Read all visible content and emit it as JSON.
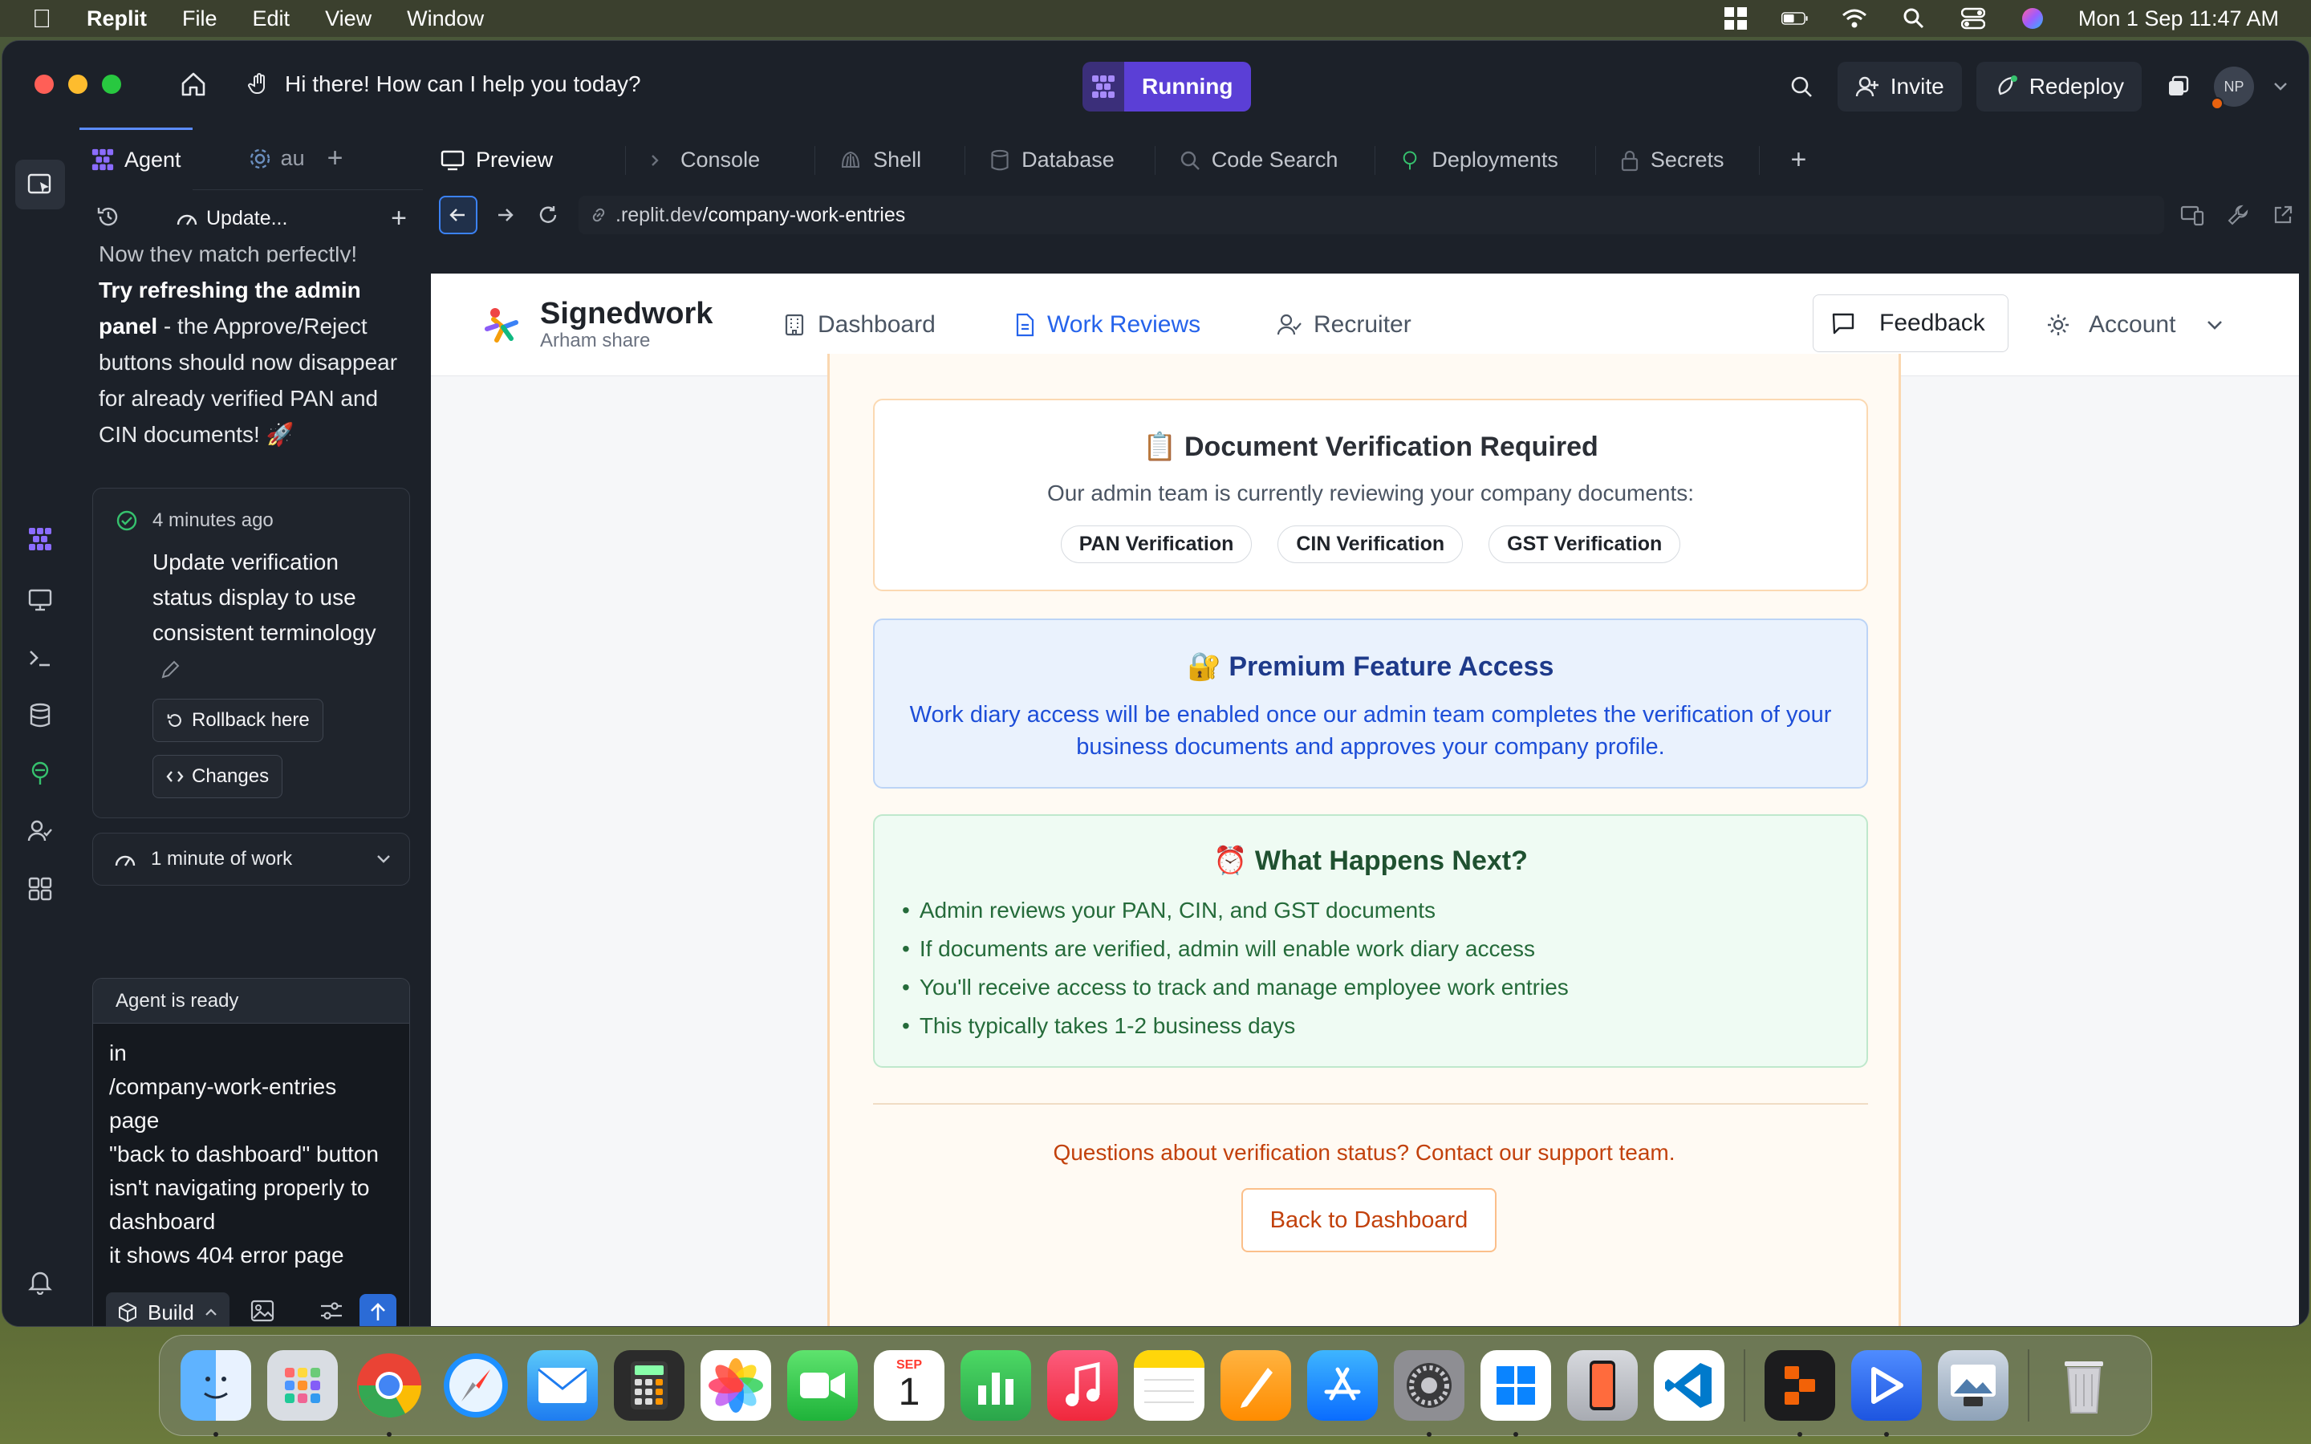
{
  "menubar": {
    "app": "Replit",
    "items": [
      "File",
      "Edit",
      "View",
      "Window"
    ],
    "clock": "Mon 1 Sep  11:47 AM"
  },
  "titlebar": {
    "title": "Hi there! How can I help you today?",
    "status": "Running",
    "invite": "Invite",
    "redeploy": "Redeploy",
    "avatar_initials": "NP"
  },
  "agent_panel": {
    "tabs": [
      "Agent",
      "au"
    ],
    "toolbar_label": "Update...",
    "cut_line": "Now they match perfectly!",
    "message_bold": "Try refreshing the admin panel",
    "message_rest": " - the Approve/Reject buttons should now disappear for already verified PAN and CIN documents! 🚀",
    "checkpoint": {
      "time": "4 minutes ago",
      "title": "Update verification status display to use consistent terminology",
      "rollback": "Rollback here",
      "changes": "Changes"
    },
    "work_summary": "1 minute of work",
    "input": {
      "status": "Agent is ready",
      "text": "in\n/company-work-entries\npage\n\"back to dashboard\" button\nisn't navigating properly to\ndashboard\nit shows 404 error page",
      "mode": "Build"
    }
  },
  "preview_tabs": [
    "Preview",
    "Console",
    "Shell",
    "Database",
    "Code Search",
    "Deployments",
    "Secrets"
  ],
  "url": {
    "host": ".replit.dev",
    "path": "/company-work-entries"
  },
  "site": {
    "brand": "Signedwork",
    "brand_sub": "Arham share",
    "nav": [
      "Dashboard",
      "Work Reviews",
      "Recruiter"
    ],
    "active_nav": "Work Reviews",
    "feedback": "Feedback",
    "account": "Account",
    "doc_box": {
      "title": "📋 Document Verification Required",
      "desc": "Our admin team is currently reviewing your company documents:",
      "pills": [
        "PAN Verification",
        "CIN Verification",
        "GST Verification"
      ]
    },
    "premium_box": {
      "title": "🔐 Premium Feature Access",
      "desc": "Work diary access will be enabled once our admin team completes the verification of your business documents and approves your company profile."
    },
    "next_box": {
      "title": "⏰ What Happens Next?",
      "items": [
        "Admin reviews your PAN, CIN, and GST documents",
        "If documents are verified, admin will enable work diary access",
        "You'll receive access to track and manage employee work entries",
        "This typically takes 1-2 business days"
      ]
    },
    "support": "Questions about verification status? Contact our support team.",
    "back_button": "Back to Dashboard"
  },
  "dock": {
    "calendar_month": "SEP",
    "calendar_day": "1"
  },
  "colors": {
    "accent": "#2563eb",
    "running": "#5b3fd6",
    "warning_text": "#c2410c"
  }
}
